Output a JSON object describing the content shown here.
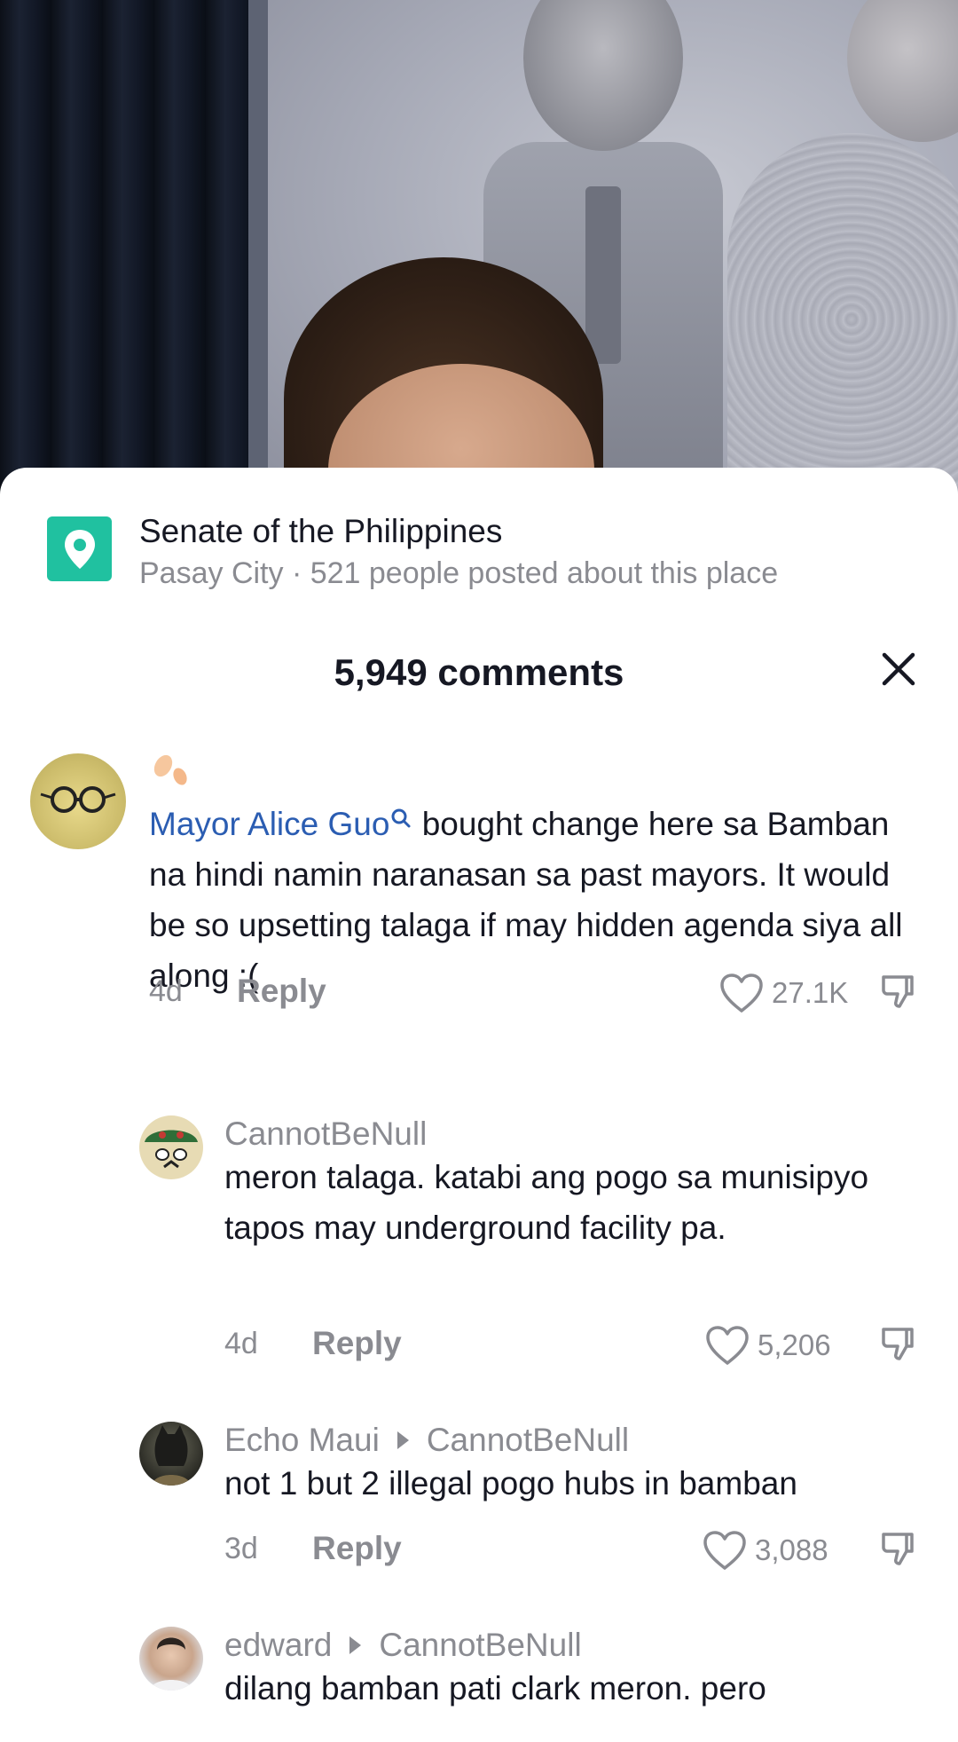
{
  "location": {
    "name": "Senate of the Philippines",
    "subtitle": "Pasay City · 521 people posted about this place",
    "icon": "location-pin-icon",
    "accent": "#20c1a0"
  },
  "comments_header": {
    "title": "5,949 comments",
    "close_icon": "close-icon"
  },
  "comments": [
    {
      "mention": "Mayor Alice Guo",
      "text": "bought change here sa Bamban na hindi namin naranasan sa past mayors. It would be so upsetting talaga if may hidden agenda siya all along :(",
      "time": "4d",
      "reply_label": "Reply",
      "likes": "27.1K"
    },
    {
      "username": "CannotBeNull",
      "text": "meron talaga. katabi ang pogo sa munisipyo tapos may underground facility pa.",
      "time": "4d",
      "reply_label": "Reply",
      "likes": "5,206"
    },
    {
      "username": "Echo Maui",
      "reply_to": "CannotBeNull",
      "text": "not 1 but 2 illegal pogo hubs in bamban",
      "time": "3d",
      "reply_label": "Reply",
      "likes": "3,088"
    },
    {
      "username": "edward",
      "reply_to": "CannotBeNull",
      "text": "dilang bamban pati clark meron. pero"
    }
  ],
  "colors": {
    "mention": "#2b5db2",
    "secondary_text": "#8a8b91",
    "primary_text": "#161823"
  }
}
